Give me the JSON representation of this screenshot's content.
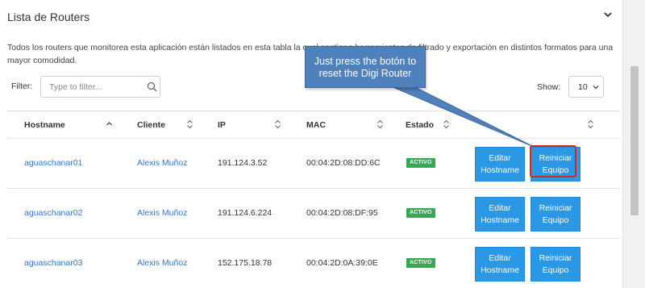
{
  "header": {
    "title": "Lista de Routers"
  },
  "description": "Todos los routers que monitorea esta aplicación están listados en esta tabla la cual contiene herramientas de filtrado y exportación en distintos formatos para una mayor comodidad.",
  "filter": {
    "label": "Filter:",
    "placeholder": "Type to filter..."
  },
  "show": {
    "label": "Show:",
    "value": "10"
  },
  "table": {
    "columns": [
      "Hostname",
      "Cliente",
      "IP",
      "MAC",
      "Estado"
    ],
    "rows": [
      {
        "hostname": "aguaschanar01",
        "cliente": "Alexis Muñoz",
        "ip": "191.124.3.52",
        "mac": "00:04:2D:08:DD:6C",
        "estado": "ACTIVO",
        "edit_label": "Editar Hostname",
        "reset_label": "Reiniciar Equipo"
      },
      {
        "hostname": "aguaschanar02",
        "cliente": "Alexis Muñoz",
        "ip": "191.124.6.224",
        "mac": "00:04:2D:08:DF:95",
        "estado": "ACTIVO",
        "edit_label": "Editar Hostname",
        "reset_label": "Reiniciar Equipo"
      },
      {
        "hostname": "aguaschanar03",
        "cliente": "Alexis Muñoz",
        "ip": "152.175.18.78",
        "mac": "00:04:2D:0A:39:0E",
        "estado": "ACTIVO",
        "edit_label": "Editar Hostname",
        "reset_label": "Reiniciar Equipo"
      }
    ]
  },
  "annotation": {
    "text": "Just press the botón to reset the Digi Router"
  },
  "icons": {
    "collapse": "chevron-down-icon",
    "search": "search-icon",
    "sort_asc": "sort-asc-icon",
    "sort": "sort-icon"
  },
  "colors": {
    "accent": "#2b98e6",
    "link": "#3a76c4",
    "status_active": "#34a853",
    "callout": "#4f81bd",
    "highlight": "#d2281f"
  }
}
